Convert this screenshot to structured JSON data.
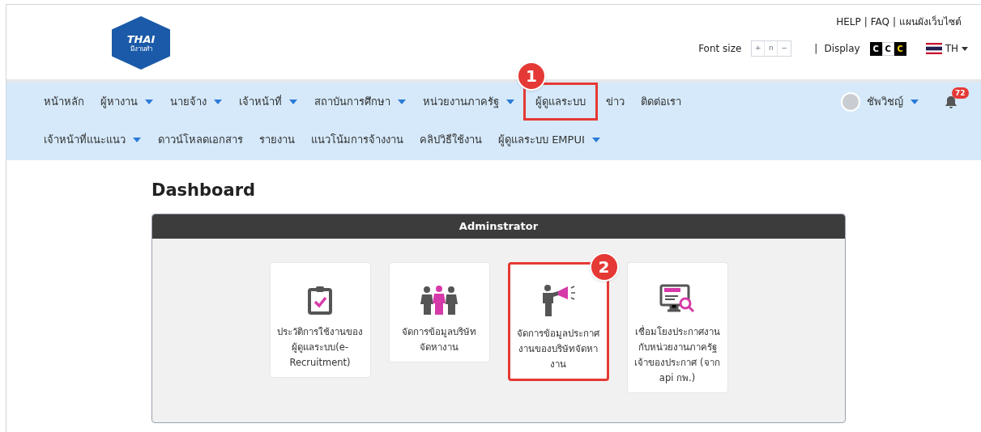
{
  "logo": {
    "title": "THAI",
    "subtitle": "มีงานทำ"
  },
  "top_links": [
    "HELP",
    "|",
    "FAQ",
    "|",
    "แผนผังเว็บไซต์"
  ],
  "font_size": {
    "label": "Font size",
    "buttons": [
      "+",
      "n",
      "−"
    ]
  },
  "display": {
    "separator": "|",
    "label": "Display",
    "buttons": [
      {
        "label": "C",
        "kind": "dark"
      },
      {
        "label": "C",
        "kind": "light"
      },
      {
        "label": "C",
        "kind": "yellow"
      }
    ]
  },
  "language": {
    "label": "TH"
  },
  "nav_rows": [
    [
      {
        "label": "หน้าหลัก",
        "dropdown": false,
        "highlighted": false
      },
      {
        "label": "ผู้หางาน",
        "dropdown": true,
        "highlighted": false
      },
      {
        "label": "นายจ้าง",
        "dropdown": true,
        "highlighted": false
      },
      {
        "label": "เจ้าหน้าที่",
        "dropdown": true,
        "highlighted": false
      },
      {
        "label": "สถาบันการศึกษา",
        "dropdown": true,
        "highlighted": false
      },
      {
        "label": "หน่วยงานภาครัฐ",
        "dropdown": true,
        "highlighted": false
      },
      {
        "label": "ผู้ดูแลระบบ",
        "dropdown": false,
        "highlighted": true,
        "step": "1"
      },
      {
        "label": "ข่าว",
        "dropdown": false,
        "highlighted": false
      },
      {
        "label": "ติดต่อเรา",
        "dropdown": false,
        "highlighted": false
      }
    ],
    [
      {
        "label": "เจ้าหน้าที่แนะแนว",
        "dropdown": true,
        "highlighted": false
      },
      {
        "label": "ดาวน์โหลดเอกสาร",
        "dropdown": false,
        "highlighted": false
      },
      {
        "label": "รายงาน",
        "dropdown": false,
        "highlighted": false
      },
      {
        "label": "แนวโน้มการจ้างงาน",
        "dropdown": false,
        "highlighted": false
      },
      {
        "label": "คลิปวิธีใช้งาน",
        "dropdown": false,
        "highlighted": false
      },
      {
        "label": "ผู้ดูแลระบบ EMPUI",
        "dropdown": true,
        "highlighted": false
      }
    ]
  ],
  "user": {
    "name": "ชัพวิชญ์",
    "notifications": "72"
  },
  "page_title": "Dashboard",
  "panel": {
    "title": "Adminstrator",
    "cards": [
      {
        "kind": "clipboard",
        "label": "ประวัติการใช้งานของผู้ดูแลระบบ(e-Recruitment)",
        "highlighted": false
      },
      {
        "kind": "team",
        "label": "จัดการข้อมูลบริษัทจัดหางาน",
        "highlighted": false
      },
      {
        "kind": "megaphone",
        "label": "จัดการข้อมูลประกาศงานของบริษัทจัดหางาน",
        "highlighted": true,
        "step": "2"
      },
      {
        "kind": "monitor",
        "label": "เชื่อมโยงประกาศงานกับหน่วยงานภาครัฐเจ้าของประกาศ (จาก api กพ.)",
        "highlighted": false
      }
    ]
  }
}
